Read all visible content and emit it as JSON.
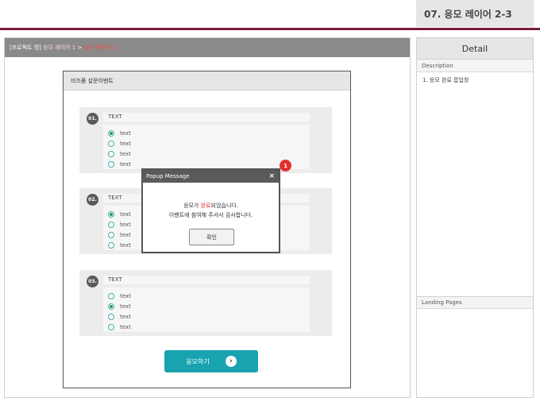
{
  "page_tag": "07. 응모 레이어 2-3",
  "breadcrumb": {
    "project": "[프로젝트 명]",
    "seg1": "응모 레이어 1",
    "sep": ">",
    "current": "응모 레이어 2"
  },
  "mobile": {
    "header_title": "비즈폼 설문이벤트",
    "questions": [
      {
        "num": "01.",
        "text": "TEXT",
        "options": [
          "text",
          "text",
          "text",
          "text"
        ],
        "selected": 0
      },
      {
        "num": "02.",
        "text": "TEXT",
        "options": [
          "text",
          "text",
          "text",
          "text"
        ],
        "selected": 0
      },
      {
        "num": "03.",
        "text": "TEXT",
        "options": [
          "text",
          "text",
          "text",
          "text"
        ],
        "selected": 1
      }
    ],
    "submit_label": "응모하기",
    "submit_icon": "arrow-right-icon"
  },
  "popup": {
    "title": "Popup Message",
    "close": "×",
    "line1_pre": "응모가 ",
    "line1_hl": "완료",
    "line1_post": "되었습니다.",
    "line2": "이벤트에 참여해 주셔서 감사합니다.",
    "ok_label": "확인",
    "badge": "1"
  },
  "detail": {
    "title": "Detail",
    "description_label": "Description",
    "items": [
      "1.  응모 완료 팝업창"
    ],
    "landing_label": "Landing Pages"
  }
}
